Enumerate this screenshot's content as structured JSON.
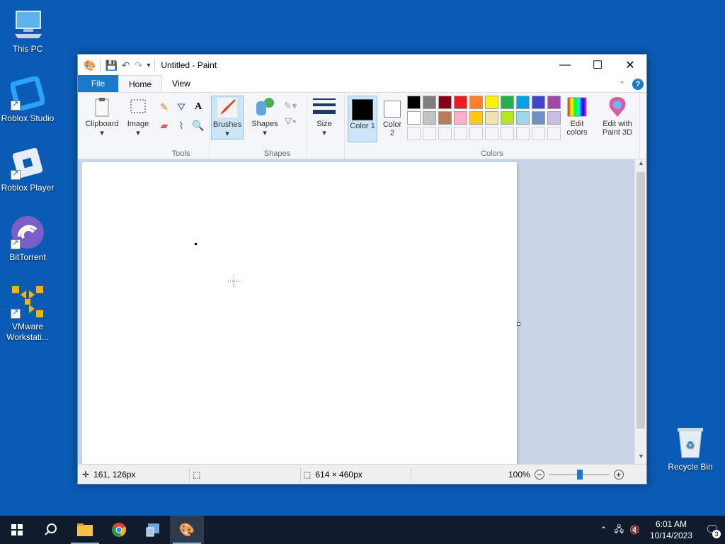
{
  "desktop": {
    "icons": [
      {
        "label": "This PC"
      },
      {
        "label": "Roblox Studio"
      },
      {
        "label": "Roblox Player"
      },
      {
        "label": "BitTorrent"
      },
      {
        "label": "VMware Workstati..."
      },
      {
        "label": "Recycle Bin"
      }
    ]
  },
  "window": {
    "title": "Untitled - Paint",
    "controls": {
      "minimize": "—",
      "maximize": "☐",
      "close": "✕"
    }
  },
  "ribbon": {
    "tabs": [
      {
        "label": "File"
      },
      {
        "label": "Home"
      },
      {
        "label": "View"
      }
    ],
    "clipboard": {
      "label": "Clipboard"
    },
    "image": {
      "label": "Image"
    },
    "tools_group": "Tools",
    "brushes": {
      "label": "Brushes"
    },
    "shapes": {
      "label": "Shapes"
    },
    "shapes_group": "Shapes",
    "size": {
      "label": "Size"
    },
    "color1": {
      "label": "Color 1"
    },
    "color2": {
      "label": "Color 2"
    },
    "edit_colors": {
      "label": "Edit colors"
    },
    "edit_paint3d": {
      "label": "Edit with Paint 3D"
    },
    "colors_group": "Colors"
  },
  "palette": {
    "row1": [
      "#000000",
      "#7f7f7f",
      "#880015",
      "#ed1c24",
      "#ff7f27",
      "#fff200",
      "#22b14c",
      "#00a2e8",
      "#3f48cc",
      "#a349a4"
    ],
    "row2": [
      "#ffffff",
      "#c3c3c3",
      "#b97a57",
      "#ffaec9",
      "#ffc90e",
      "#efe4b0",
      "#b5e61d",
      "#99d9ea",
      "#7092be",
      "#c8bfe7"
    ],
    "color1": "#000000",
    "color2": "#ffffff"
  },
  "status": {
    "cursor_pos": "161, 126px",
    "canvas_size": "614 × 460px",
    "zoom": "100%"
  },
  "taskbar": {
    "time": "6:01 AM",
    "date": "10/14/2023",
    "notifications": "3"
  }
}
